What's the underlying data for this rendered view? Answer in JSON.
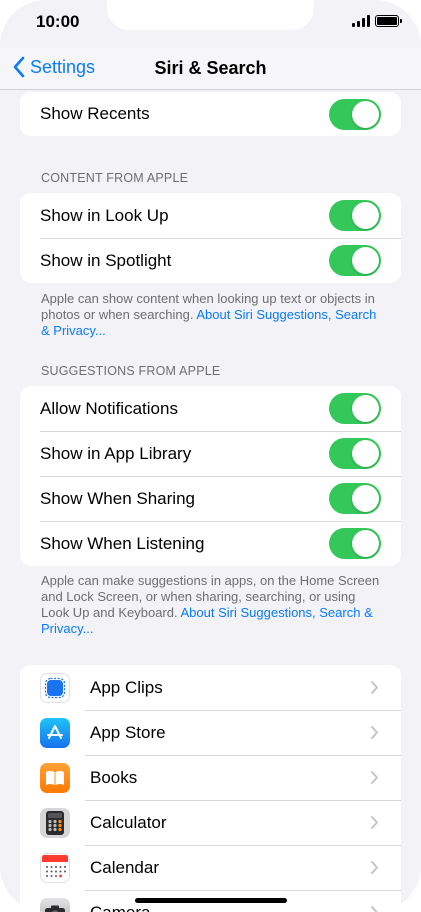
{
  "status_bar": {
    "time": "10:00"
  },
  "nav": {
    "back_label": "Settings",
    "title": "Siri & Search"
  },
  "top_group": {
    "items": [
      {
        "label": "Show Recents",
        "on": true
      }
    ]
  },
  "content_from_apple": {
    "header": "CONTENT FROM APPLE",
    "items": [
      {
        "label": "Show in Look Up",
        "on": true
      },
      {
        "label": "Show in Spotlight",
        "on": true
      }
    ],
    "footnote_text": "Apple can show content when looking up text or objects in photos or when searching.",
    "footnote_link": "About Siri Suggestions, Search & Privacy..."
  },
  "suggestions_from_apple": {
    "header": "SUGGESTIONS FROM APPLE",
    "items": [
      {
        "label": "Allow Notifications",
        "on": true
      },
      {
        "label": "Show in App Library",
        "on": true
      },
      {
        "label": "Show When Sharing",
        "on": true
      },
      {
        "label": "Show When Listening",
        "on": true
      }
    ],
    "footnote_text": "Apple can make suggestions in apps, on the Home Screen and Lock Screen, or when sharing, searching, or using Look Up and Keyboard.",
    "footnote_link": "About Siri Suggestions, Search & Privacy..."
  },
  "apps": {
    "items": [
      {
        "label": "App Clips",
        "icon": "app-clips-icon"
      },
      {
        "label": "App Store",
        "icon": "app-store-icon"
      },
      {
        "label": "Books",
        "icon": "books-icon"
      },
      {
        "label": "Calculator",
        "icon": "calculator-icon"
      },
      {
        "label": "Calendar",
        "icon": "calendar-icon"
      },
      {
        "label": "Camera",
        "icon": "camera-icon"
      }
    ]
  },
  "colors": {
    "accent": "#0a7aff",
    "toggle_on": "#34c759",
    "background": "#f2f2f7",
    "secondary_text": "#6d6d72"
  }
}
